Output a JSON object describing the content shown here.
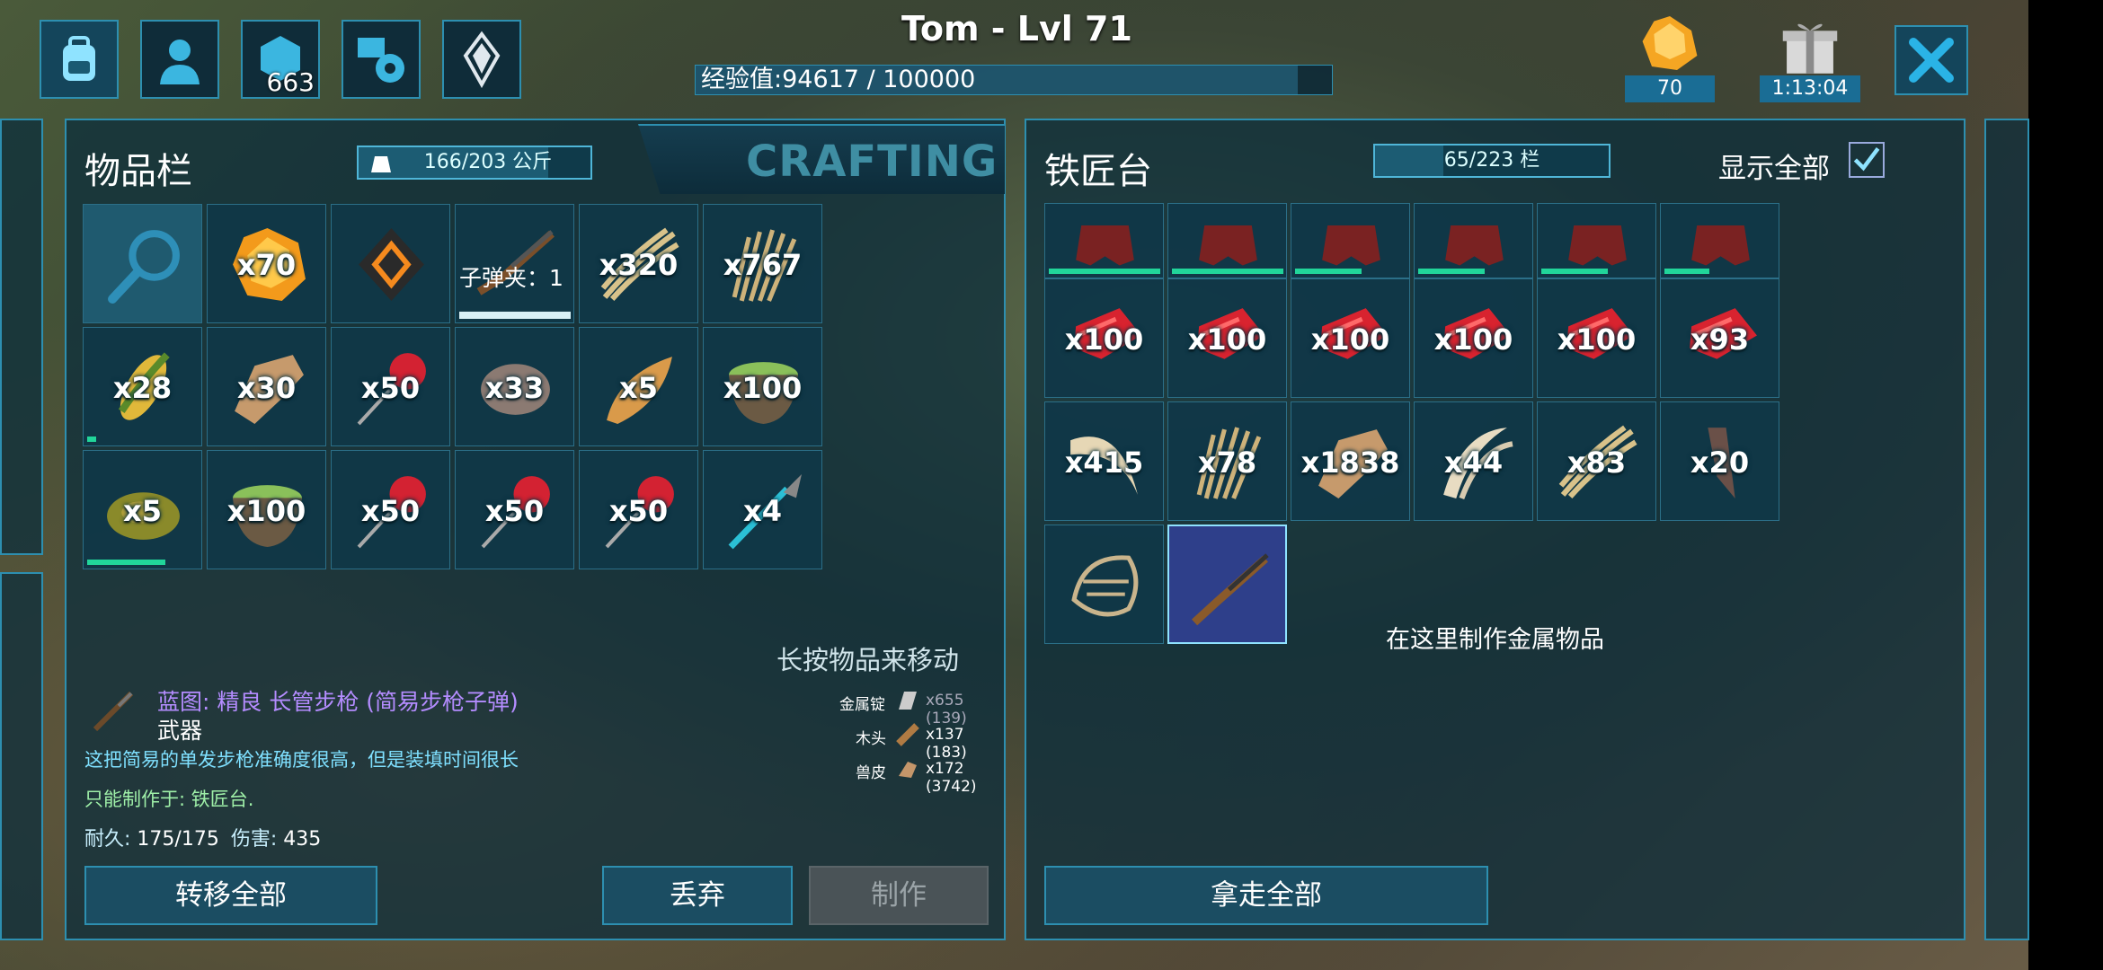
{
  "header": {
    "player_title": "Tom - Lvl 71",
    "xp_text": "经验值:94617 / 100000",
    "xp_fraction": 0.946,
    "engram_points": "663",
    "resource_count": "70",
    "gift_timer": "1:13:04"
  },
  "inventory": {
    "title": "物品栏",
    "weight": "166/203 公斤",
    "weight_fraction": 0.818,
    "crafting_tab": "CRAFTING",
    "hint": "长按物品来移动",
    "slots": [
      {
        "qty": "",
        "icon": "search-icon"
      },
      {
        "qty": "x70",
        "icon": "amber-icon"
      },
      {
        "qty": "",
        "icon": "implant-icon"
      },
      {
        "qty": "",
        "clip": "子弹夹：1",
        "icon": "rifle-icon"
      },
      {
        "qty": "x320",
        "icon": "fiber-icon"
      },
      {
        "qty": "x767",
        "icon": "thatch-icon"
      },
      {
        "qty": "x28",
        "icon": "corn-icon",
        "durability": 0.08
      },
      {
        "qty": "x30",
        "icon": "hide-icon"
      },
      {
        "qty": "x50",
        "icon": "dart-icon"
      },
      {
        "qty": "x33",
        "icon": "stone-icon"
      },
      {
        "qty": "x5",
        "icon": "chitin-icon"
      },
      {
        "qty": "x100",
        "icon": "bowl-icon"
      },
      {
        "qty": "x5",
        "icon": "meat-icon",
        "durability": 0.7
      },
      {
        "qty": "x100",
        "icon": "bowl-icon"
      },
      {
        "qty": "x50",
        "icon": "dart-icon"
      },
      {
        "qty": "x50",
        "icon": "dart-icon"
      },
      {
        "qty": "x50",
        "icon": "dart-icon"
      },
      {
        "qty": "x4",
        "icon": "spear-icon"
      }
    ],
    "blueprint": {
      "name": "蓝图: 精良 长管步枪 (简易步枪子弹)",
      "type": "武器",
      "desc1": "这把简易的单发步枪准确度很高，但是装填时间很长",
      "desc2": "只能制作于: 铁匠台.",
      "durability_label": "耐久:",
      "durability_value": "175/175",
      "damage_label": "伤害:",
      "damage_value": "435"
    },
    "requirements": [
      {
        "label": "金属锭",
        "amount": "x655",
        "have": "(139)",
        "icon": "ingot-icon"
      },
      {
        "label": "木头",
        "amount": "x137",
        "have": "(183)",
        "icon": "wood-icon"
      },
      {
        "label": "兽皮",
        "amount": "x172",
        "have": "(3742)",
        "icon": "hide-icon"
      }
    ],
    "buttons": {
      "transfer_all": "转移全部",
      "drop": "丢弃",
      "craft": "制作"
    }
  },
  "smithy": {
    "title": "铁匠台",
    "slots_text": "65/223 栏",
    "slots_fraction": 0.291,
    "show_all_label": "显示全部",
    "show_all_checked": true,
    "empty_hint": "在这里制作金属物品",
    "take_all": "拿走全部",
    "slots": [
      {
        "qty": "",
        "icon": "armor-icon",
        "durability": 1.0
      },
      {
        "qty": "",
        "icon": "armor-icon",
        "durability": 1.0
      },
      {
        "qty": "",
        "icon": "armor-icon",
        "durability": 0.6
      },
      {
        "qty": "",
        "icon": "armor-icon",
        "durability": 0.6
      },
      {
        "qty": "",
        "icon": "armor-icon",
        "durability": 0.6
      },
      {
        "qty": "",
        "icon": "armor-icon",
        "durability": 0.4
      },
      {
        "qty": "x100",
        "icon": "meat-raw-icon"
      },
      {
        "qty": "x100",
        "icon": "meat-raw-icon"
      },
      {
        "qty": "x100",
        "icon": "meat-raw-icon"
      },
      {
        "qty": "x100",
        "icon": "meat-raw-icon"
      },
      {
        "qty": "x100",
        "icon": "meat-raw-icon"
      },
      {
        "qty": "x93",
        "icon": "meat-raw-icon"
      },
      {
        "qty": "x415",
        "icon": "tusk-icon"
      },
      {
        "qty": "x78",
        "icon": "thatch-icon"
      },
      {
        "qty": "x1838",
        "icon": "hide-icon"
      },
      {
        "qty": "x44",
        "icon": "claw-icon"
      },
      {
        "qty": "x83",
        "icon": "fiber-icon"
      },
      {
        "qty": "x20",
        "icon": "tooth-icon"
      },
      {
        "qty": "",
        "icon": "saddle-icon"
      },
      {
        "qty": "",
        "icon": "rifle-blueprint-icon",
        "blueprint": true
      }
    ]
  },
  "colors": {
    "panel_border": "#2d8fb0",
    "durability": "#21d59a",
    "blueprint_name": "#b48cff",
    "desc": "#7fe0ff"
  }
}
